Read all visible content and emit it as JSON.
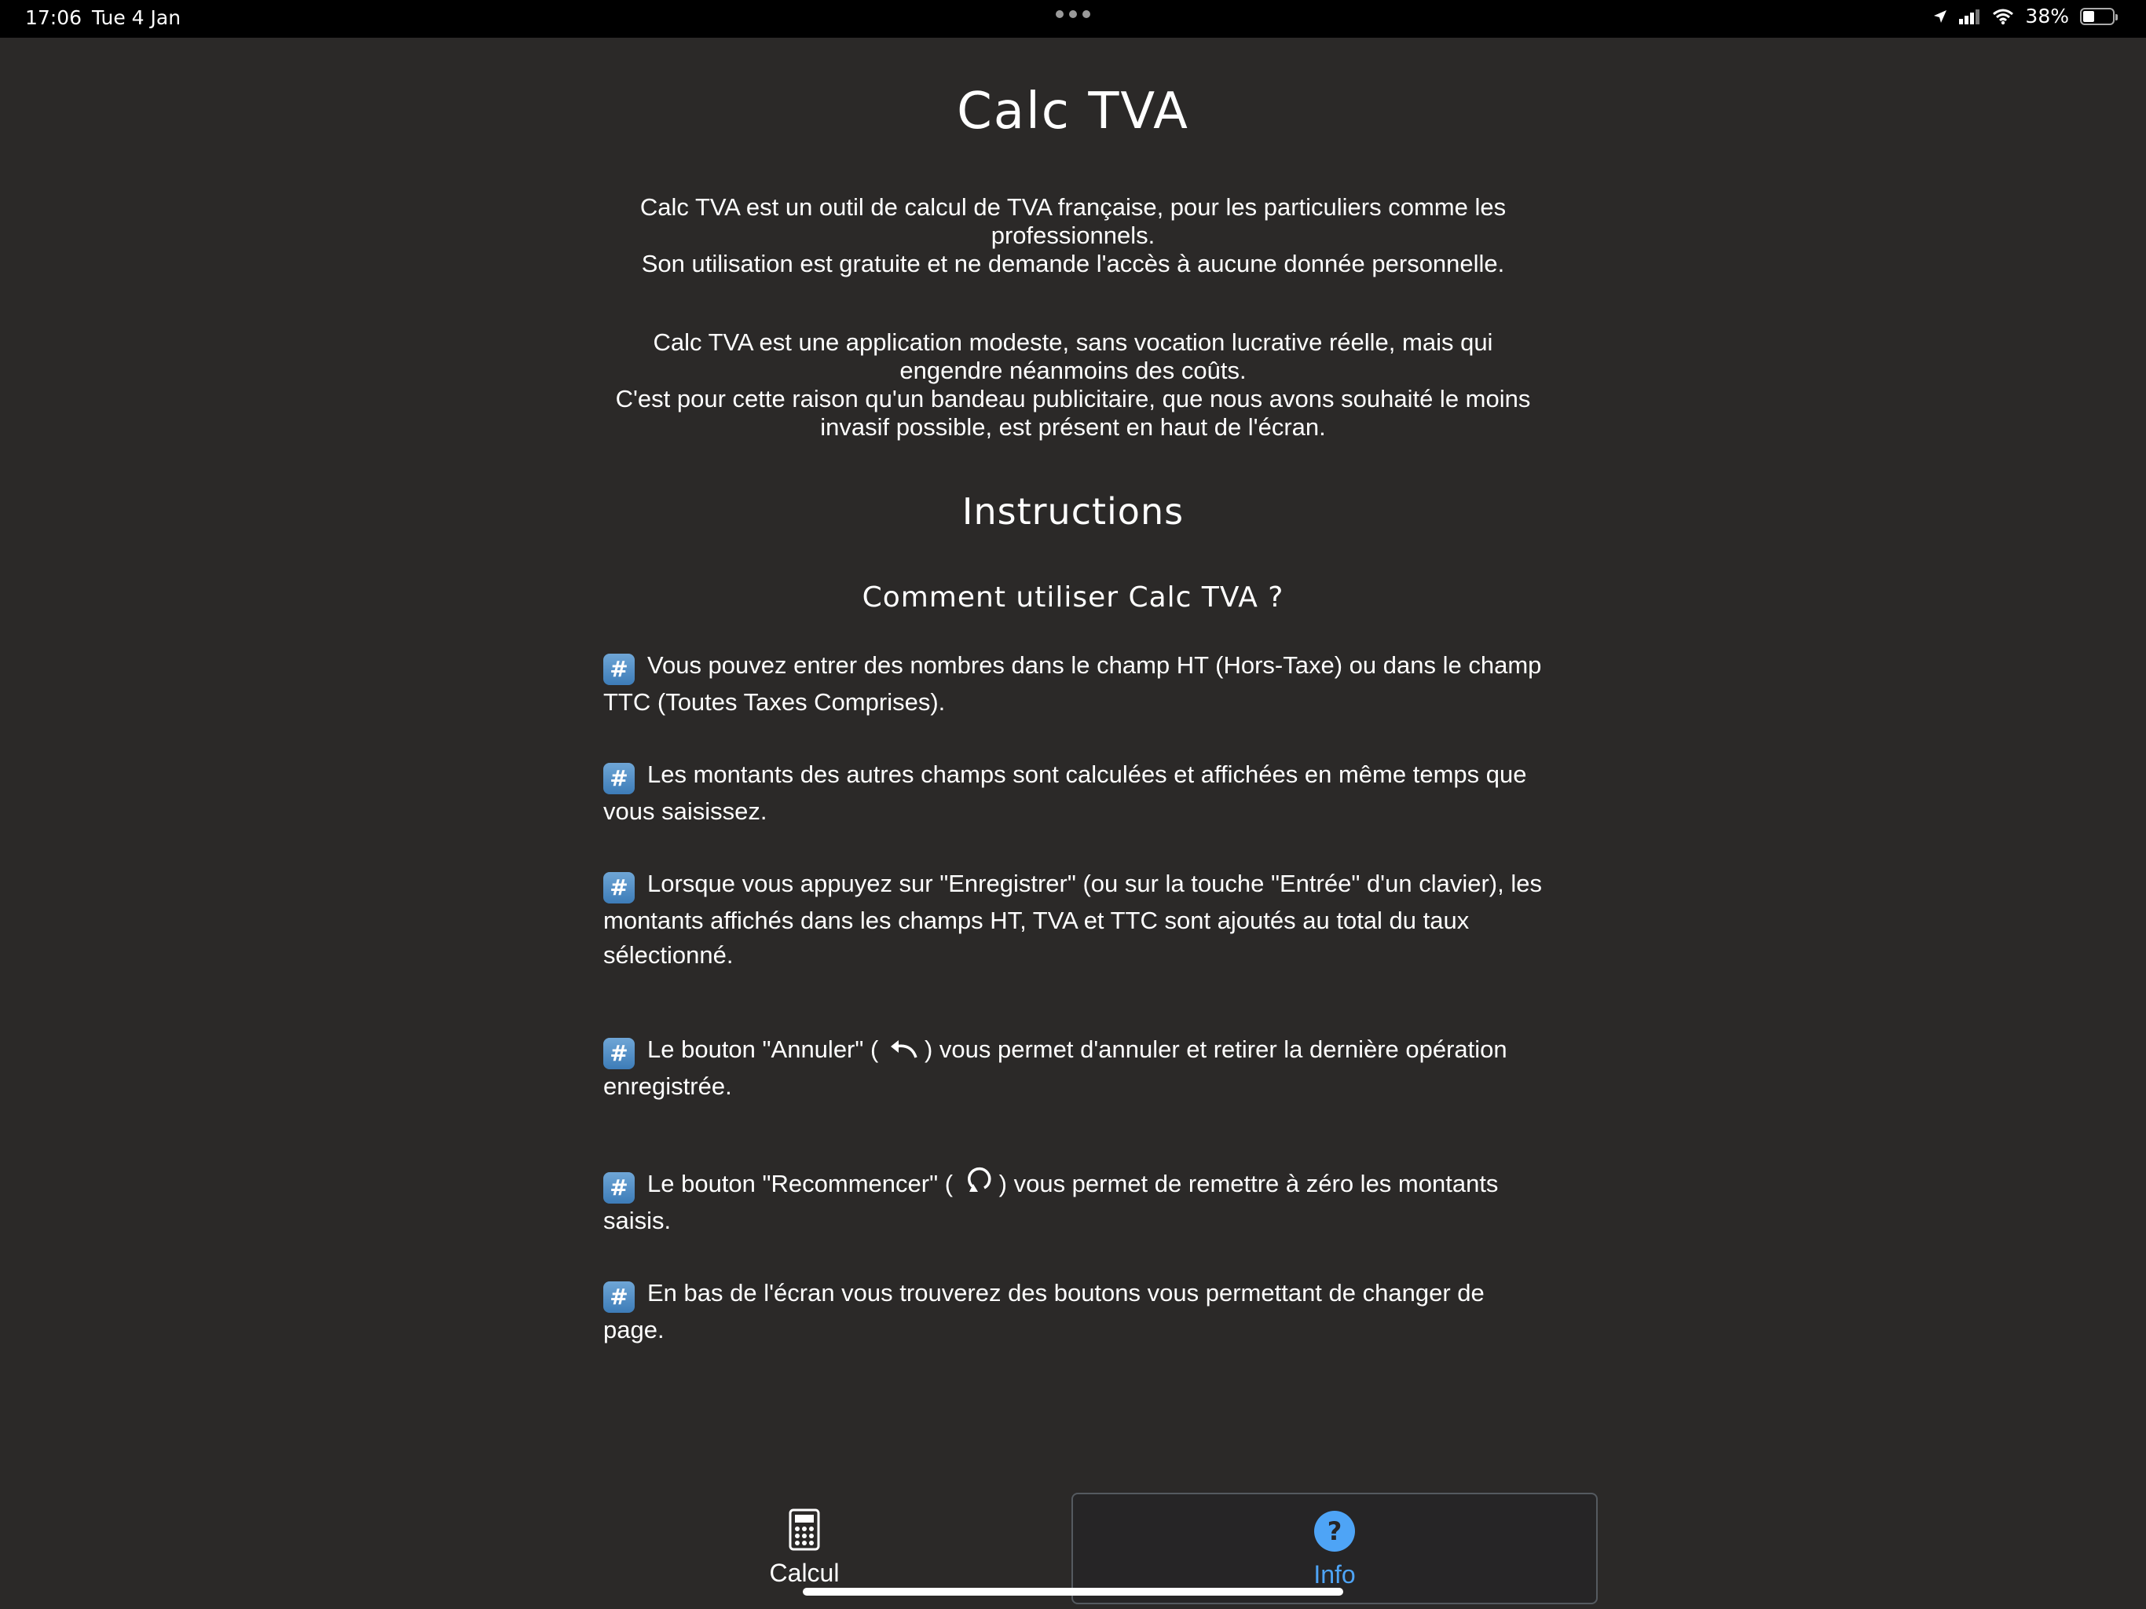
{
  "status_bar": {
    "time": "17:06",
    "date": "Tue 4 Jan",
    "battery_percent": "38%",
    "battery_level": 0.38
  },
  "page": {
    "title": "Calc TVA",
    "intro_1": [
      "Calc TVA est un outil de calcul de TVA française, pour les particuliers comme les",
      "professionnels.",
      "Son utilisation est gratuite et ne demande l'accès à aucune donnée personnelle."
    ],
    "intro_2": [
      "Calc TVA est une application modeste, sans vocation lucrative réelle, mais qui",
      "engendre néanmoins des coûts.",
      "C'est pour cette raison qu'un bandeau publicitaire, que nous avons souhaité le moins",
      "invasif possible, est présent en haut de l'écran."
    ],
    "instructions_heading": "Instructions",
    "how_heading": "Comment utiliser Calc TVA ?",
    "steps": {
      "s1": "Vous pouvez entrer des nombres dans le champ HT (Hors-Taxe) ou dans le champ TTC (Toutes Taxes Comprises).",
      "s2": "Les montants des autres champs sont calculées et affichées en même temps que vous saisissez.",
      "s3": "Lorsque vous appuyez sur \"Enregistrer\" (ou sur la touche \"Entrée\" d'un clavier), les montants affichés dans les champs HT, TVA et TTC sont ajoutés au total du taux sélectionné.",
      "s4_before": "Le bouton \"Annuler\" (",
      "s4_after": ") vous permet d'annuler et retirer la dernière opération enregistrée.",
      "s5_before": "Le bouton \"Recommencer\" (",
      "s5_after": ") vous permet de remettre à zéro les montants saisis.",
      "s6": "En bas de l'écran vous trouverez des boutons vous permettant de changer de page."
    }
  },
  "tabs": {
    "calcul": "Calcul",
    "info": "Info"
  },
  "colors": {
    "background": "#2b2928",
    "accent": "#4ea4f6"
  },
  "icons": {
    "step_bullet": "hash-keycap-icon",
    "undo": "undo-icon",
    "restart": "restart-icon",
    "calcul_tab": "calculator-icon",
    "info_tab": "question-circle-icon"
  }
}
